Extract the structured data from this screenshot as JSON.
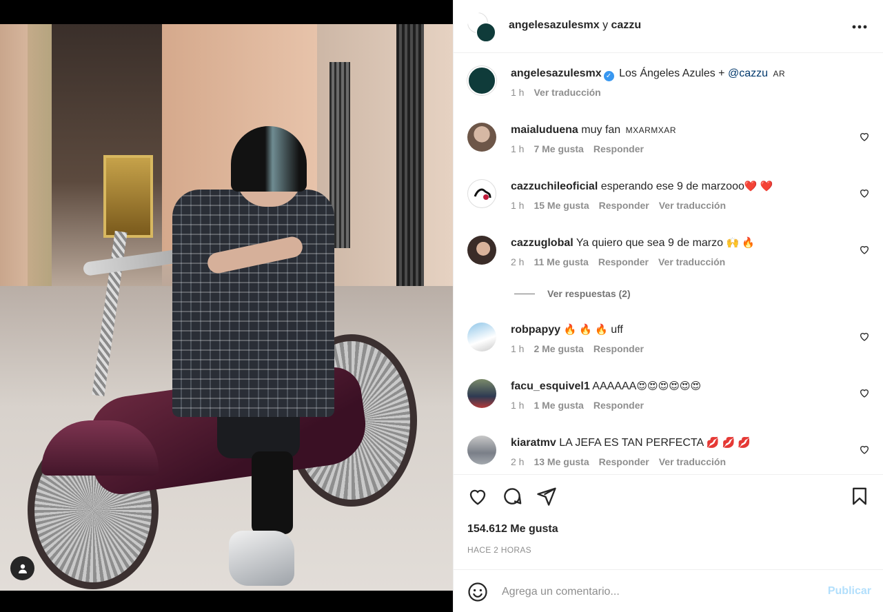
{
  "post": {
    "media_alt_icon": "user-tag-icon",
    "header": {
      "user1": "angelesazulesmx",
      "and": "y",
      "user2": "cazzu"
    },
    "caption": {
      "username": "angelesazulesmx",
      "text": "Los Ángeles Azules + ",
      "mention": "@cazzu",
      "flag": "AR",
      "time": "1 h",
      "translate": "Ver traducción"
    },
    "comments": [
      {
        "username": "maialuduena",
        "text": "muy fan",
        "flag": "MXARMXAR",
        "time": "1 h",
        "likes": "7 Me gusta",
        "reply": "Responder",
        "translate": ""
      },
      {
        "username": "cazzuchileoficial",
        "text": "esperando ese 9 de marzooo",
        "emoji": "❤️ ❤️",
        "time": "1 h",
        "likes": "15 Me gusta",
        "reply": "Responder",
        "translate": "Ver traducción"
      },
      {
        "username": "cazzuglobal",
        "text": "Ya quiero que sea 9 de marzo",
        "emoji": "🙌 🔥",
        "time": "2 h",
        "likes": "11 Me gusta",
        "reply": "Responder",
        "translate": "Ver traducción"
      },
      {
        "username": "robpapyy",
        "emoji": "🔥 🔥 🔥",
        "text": "uff",
        "time": "1 h",
        "likes": "2 Me gusta",
        "reply": "Responder",
        "translate": ""
      },
      {
        "username": "facu_esquivel1",
        "text": "AAAAAA",
        "emoji": "😍😍😍😍😍😍",
        "time": "1 h",
        "likes": "1 Me gusta",
        "reply": "Responder",
        "translate": ""
      },
      {
        "username": "kiaratmv",
        "text": "LA JEFA ES TAN PERFECTA",
        "emoji": "💋 💋 💋",
        "time": "2 h",
        "likes": "13 Me gusta",
        "reply": "Responder",
        "translate": "Ver traducción"
      }
    ],
    "view_replies": "Ver respuestas (2)",
    "likes_count": "154.612 Me gusta",
    "posted_time": "HACE 2 HORAS",
    "comment_placeholder": "Agrega un comentario...",
    "publish_label": "Publicar",
    "icons": {
      "like": "heart-icon",
      "comment": "comment-icon",
      "share": "share-icon",
      "save": "bookmark-icon",
      "more": "more-icon",
      "emoji": "emoji-icon"
    },
    "colors": {
      "link": "#00376b",
      "verified": "#3897f0",
      "muted": "#8e8e8e",
      "publish_disabled": "#b2dffc"
    }
  }
}
